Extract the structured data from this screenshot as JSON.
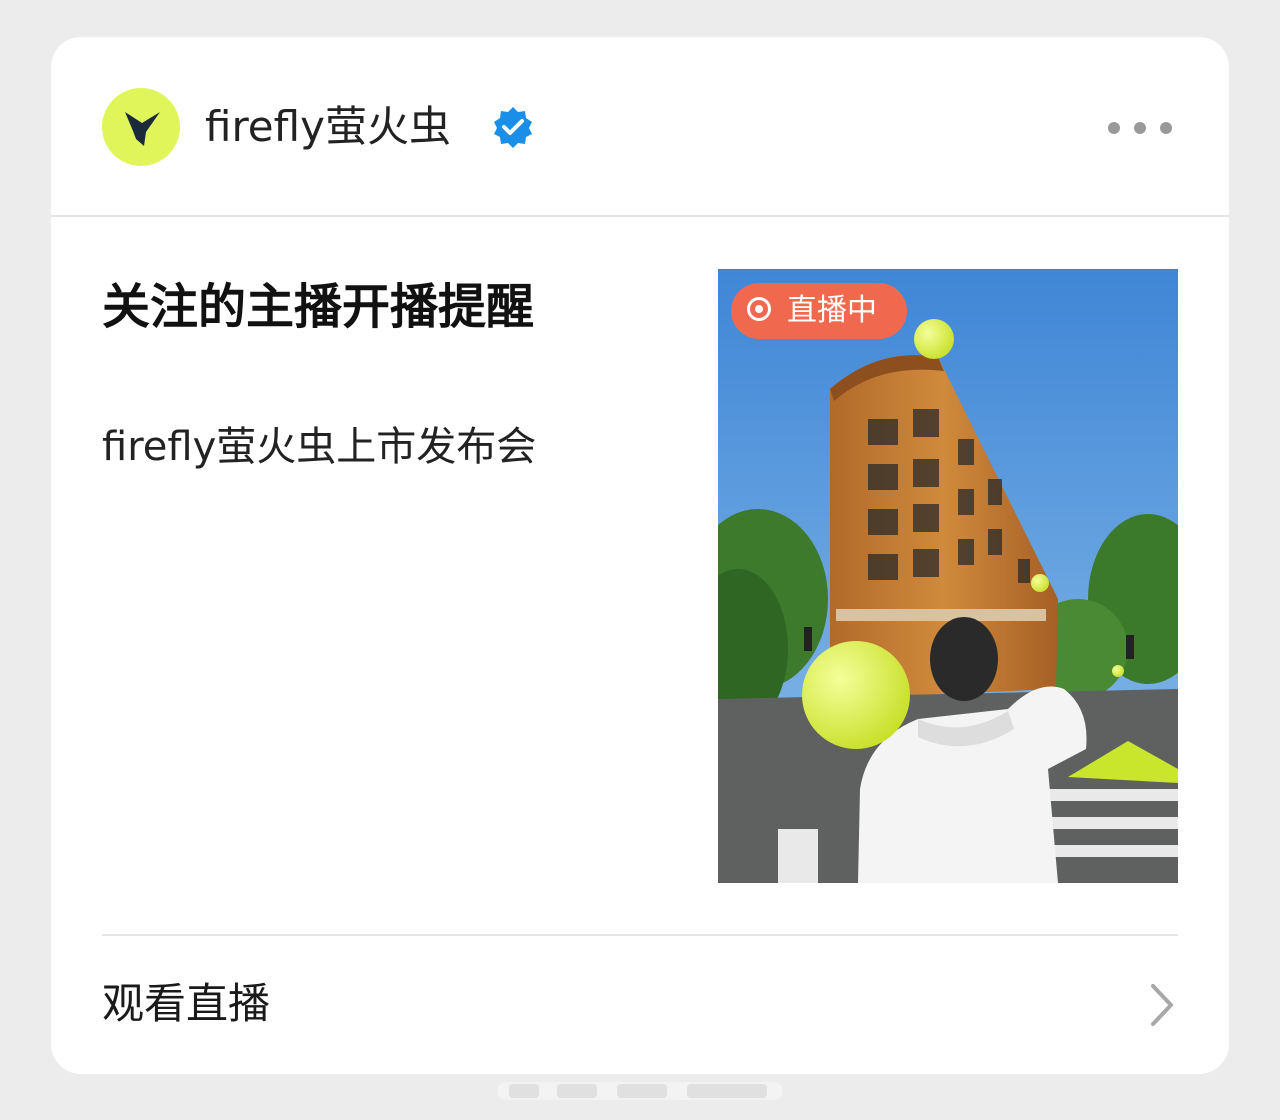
{
  "account": {
    "name": "firefly萤火虫",
    "avatar_icon": "firefly-logo-icon",
    "verified_icon": "verified-badge-icon",
    "more_icon": "more-dots-icon",
    "avatar_color": "#e0f55a",
    "verified_color": "#1b8ee8"
  },
  "notification": {
    "title": "关注的主播开播提醒",
    "subtitle": "firefly萤火虫上市发布会"
  },
  "thumbnail": {
    "badge_label": "直播中",
    "badge_icon": "live-record-icon",
    "badge_color": "#f0684e"
  },
  "action": {
    "label": "观看直播",
    "chevron_icon": "chevron-right-icon"
  }
}
